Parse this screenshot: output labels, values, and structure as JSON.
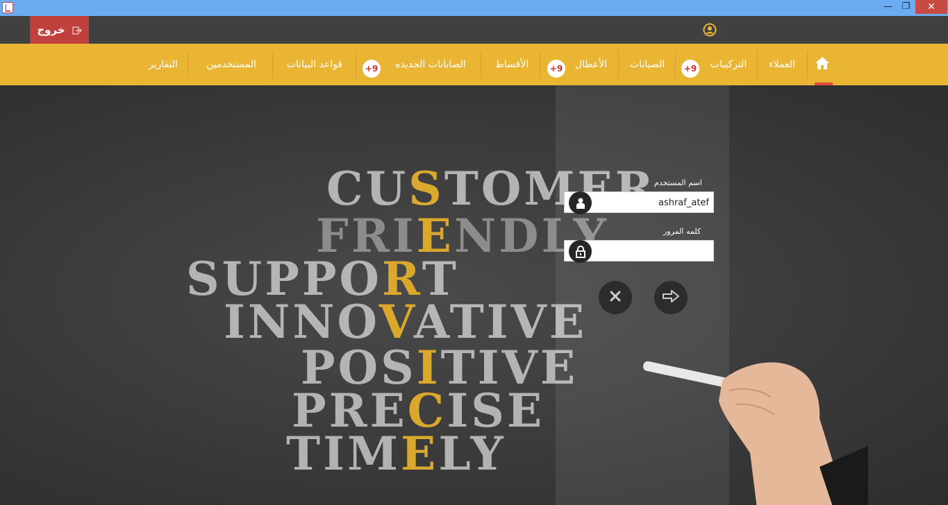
{
  "window": {
    "min_symbol": "—",
    "max_symbol": "❐",
    "close_symbol": "✕"
  },
  "topbar": {
    "logout_label": "خروج",
    "logout_icon": "logout-icon",
    "user_icon": "user-circle-icon"
  },
  "nav": {
    "home_icon": "home-icon",
    "items": [
      {
        "label": "العملاء"
      },
      {
        "label": "التركيبات",
        "badge": "+9"
      },
      {
        "label": "الصيانات"
      },
      {
        "label": "الأعطال",
        "badge": "+9"
      },
      {
        "label": "الأقساط"
      },
      {
        "label": "الصايانات الجديده",
        "badge": "+9"
      },
      {
        "label": "قواعد البيانات"
      },
      {
        "label": "المستخدمين"
      },
      {
        "label": "التقارير"
      }
    ]
  },
  "background_words": {
    "customer": [
      "CU",
      "S",
      "TOMER"
    ],
    "friendly": [
      "FRI",
      "E",
      "NDLY"
    ],
    "support": [
      "SUPPO",
      "R",
      "T"
    ],
    "innovative": [
      "INNO",
      "V",
      "ATIVE"
    ],
    "positive": [
      "POS",
      "I",
      "TIVE"
    ],
    "precise": [
      "PRE",
      "C",
      "ISE"
    ],
    "timely": [
      "TIM",
      "E",
      "LY"
    ]
  },
  "login": {
    "username_label": "اسم المستخدم",
    "username_value": "ashraf_atef",
    "password_label": "كلمه المرور",
    "password_value": "",
    "cancel_icon": "close-icon",
    "login_icon": "arrow-right-icon"
  }
}
